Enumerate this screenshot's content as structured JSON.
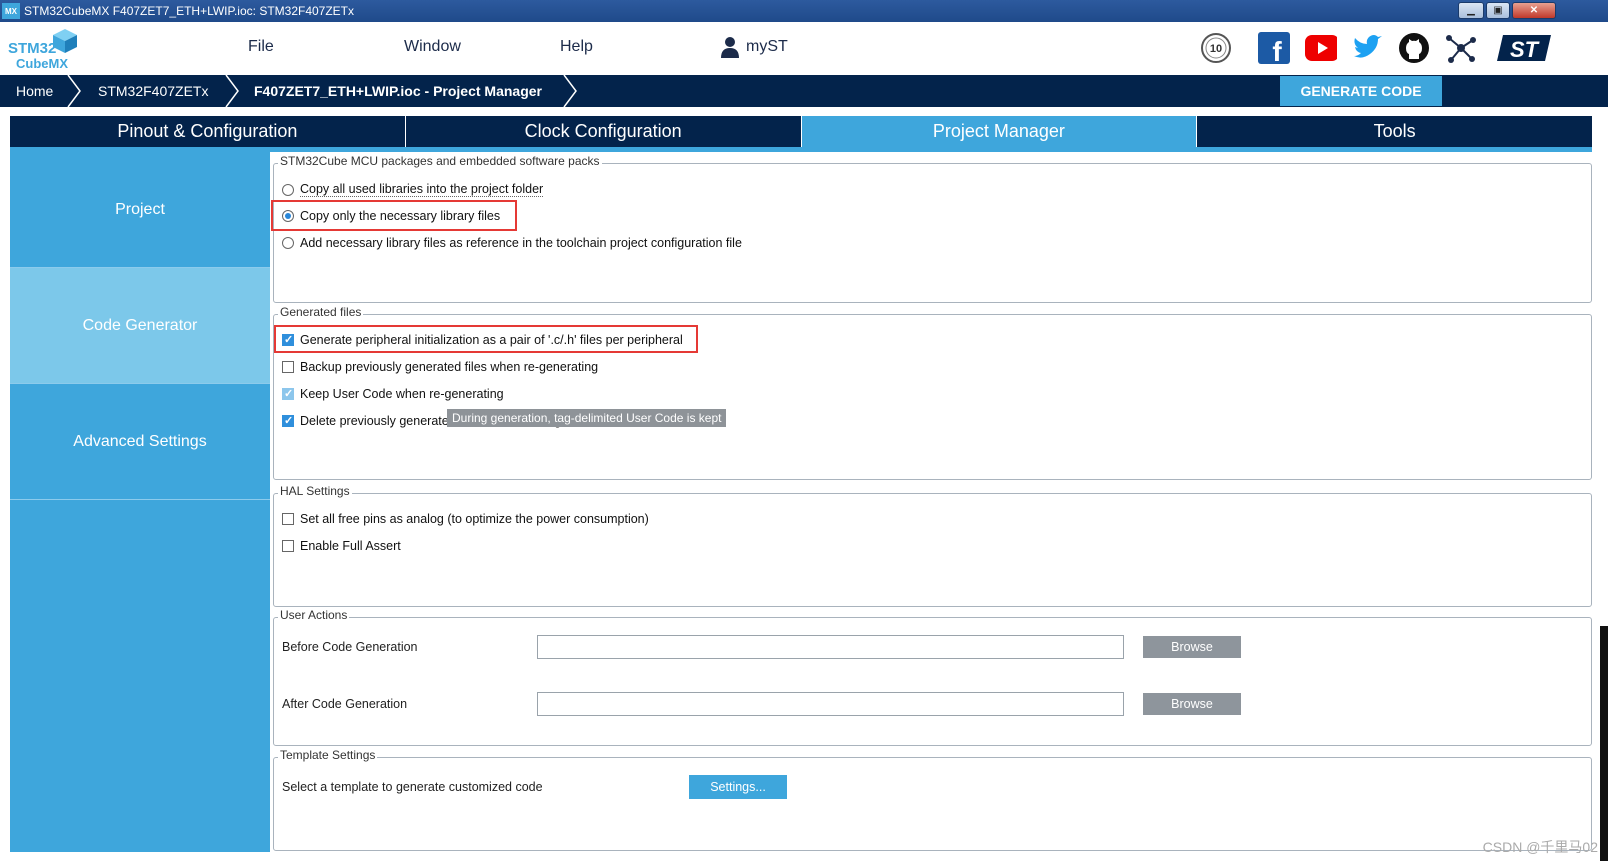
{
  "window": {
    "title": "STM32CubeMX F407ZET7_ETH+LWIP.ioc: STM32F407ZETx",
    "app_icon_text": "MX"
  },
  "logo": {
    "line1": "STM32",
    "line2": "CubeMX"
  },
  "menu": {
    "file": "File",
    "window": "Window",
    "help": "Help",
    "myst": "myST"
  },
  "breadcrumb": {
    "home": "Home",
    "mcu": "STM32F407ZETx",
    "project": "F407ZET7_ETH+LWIP.ioc - Project Manager"
  },
  "generate_button": "GENERATE CODE",
  "tabs": [
    "Pinout & Configuration",
    "Clock Configuration",
    "Project Manager",
    "Tools"
  ],
  "left_nav": [
    "Project",
    "Code Generator",
    "Advanced Settings"
  ],
  "packs": {
    "legend": "STM32Cube MCU packages and embedded software packs",
    "options": [
      "Copy all used libraries into the project folder",
      "Copy only the necessary library files",
      "Add necessary library files as reference in the toolchain project configuration file"
    ]
  },
  "generated_files": {
    "legend": "Generated files",
    "options": [
      "Generate peripheral initialization as a pair of '.c/.h' files per peripheral",
      "Backup previously generated files when re-generating",
      "Keep User Code when re-generating",
      "Delete previously generated files when not re-generated"
    ],
    "tooltip": "During generation, tag-delimited User Code is kept"
  },
  "hal": {
    "legend": "HAL Settings",
    "options": [
      "Set all free pins as analog (to optimize the power consumption)",
      "Enable Full Assert"
    ]
  },
  "user_actions": {
    "legend": "User Actions",
    "before": "Before Code Generation",
    "after": "After Code Generation",
    "browse": "Browse",
    "before_value": "",
    "after_value": ""
  },
  "template": {
    "legend": "Template Settings",
    "label": "Select a template to generate customized code",
    "button": "Settings..."
  },
  "watermark": "CSDN @千里马02",
  "colors": {
    "navy": "#03234b",
    "accent": "#3ea6dc",
    "highlight": "#e53935"
  }
}
